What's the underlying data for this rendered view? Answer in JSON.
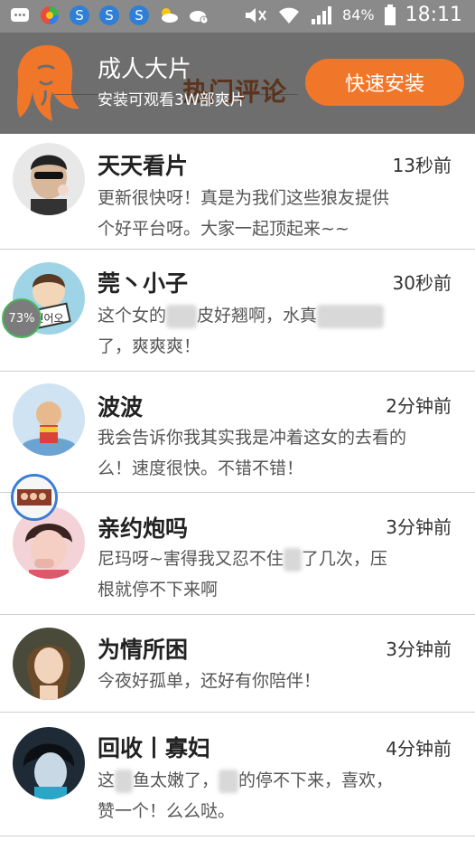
{
  "status_bar": {
    "battery": "84%",
    "time": "18:11",
    "icons": [
      "message-icon",
      "color-circle-icon",
      "s-icon",
      "s-icon",
      "s-icon",
      "cloud-icon",
      "cloud-alert-icon",
      "mute-icon",
      "wifi-icon",
      "signal-icon",
      "battery-icon"
    ]
  },
  "ad": {
    "title": "成人大片",
    "subtitle": "安装可观看3W部爽片",
    "overlay": "热门评论",
    "button": "快速安装",
    "accent": "#f0772a"
  },
  "floating_badge": "73%",
  "comments": [
    {
      "name": "天天看片",
      "time": "13秒前",
      "line1": "更新很快呀！真是为我们这些狼友提供",
      "line2": "个好平台呀。大家一起顶起来~~"
    },
    {
      "name": "莞丶小子",
      "time": "30秒前",
      "line1a": "这个女的",
      "line1b": "皮好翘啊，水真",
      "line2": "了，爽爽爽！"
    },
    {
      "name": "波波",
      "time": "2分钟前",
      "line1": "我会告诉你我其实我是冲着这女的去看的",
      "line2": "么！速度很快。不错不错！"
    },
    {
      "name": "亲约炮吗",
      "time": "3分钟前",
      "line1a": "尼玛呀~害得我又忍不住",
      "line1b": "了几次，压",
      "line2": "根就停不下来啊"
    },
    {
      "name": "为情所困",
      "time": "3分钟前",
      "line1": "今夜好孤单，还好有你陪伴！"
    },
    {
      "name": "回收丨寡妇",
      "time": "4分钟前",
      "line1a": "这",
      "line1b": "鱼太嫩了，",
      "line1c": "的停不下来，喜欢，",
      "line2": "赞一个！么么哒。"
    }
  ]
}
